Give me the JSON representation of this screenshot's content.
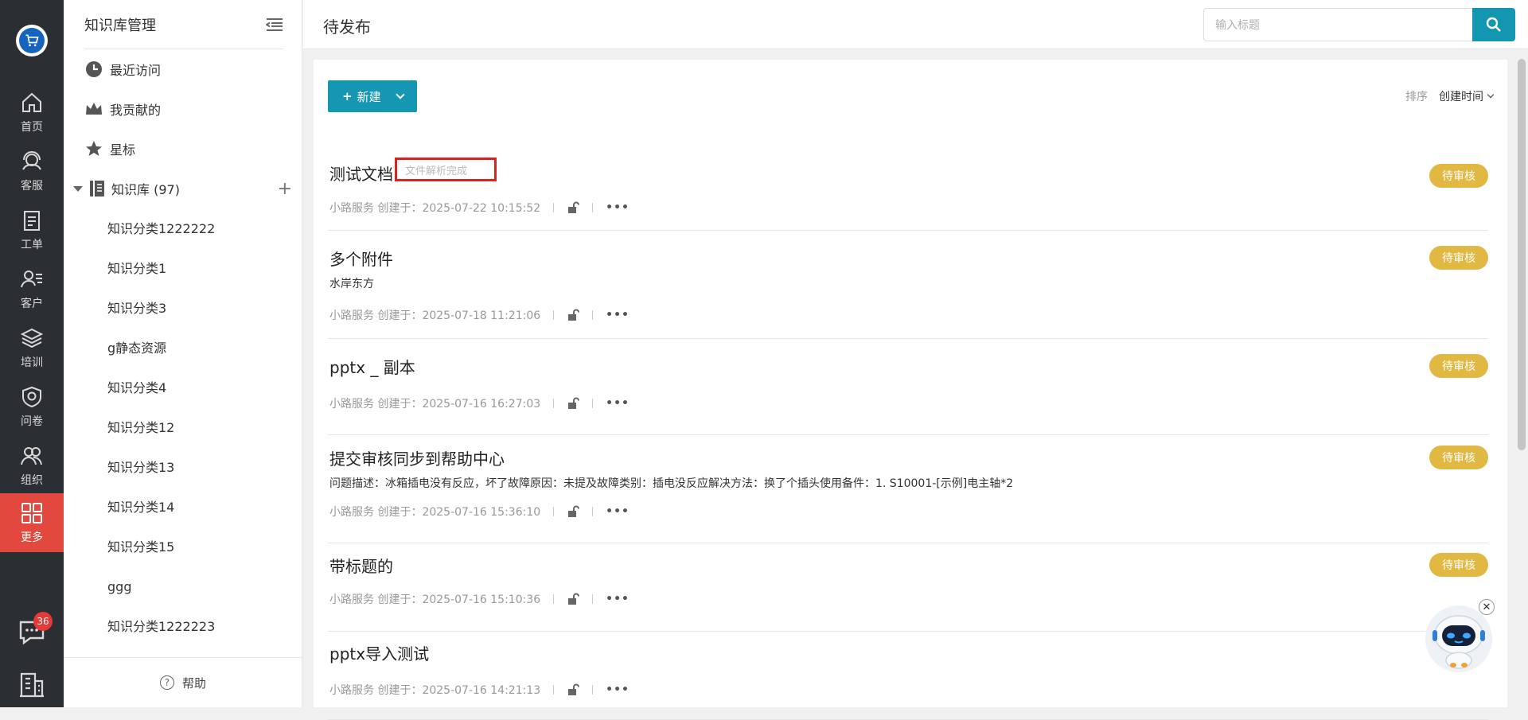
{
  "rail": {
    "items": [
      {
        "label": "首页",
        "icon": "home-icon"
      },
      {
        "label": "客服",
        "icon": "headset-icon"
      },
      {
        "label": "工单",
        "icon": "clipboard-icon"
      },
      {
        "label": "客户",
        "icon": "user-list-icon"
      },
      {
        "label": "培训",
        "icon": "layers-icon"
      },
      {
        "label": "问卷",
        "icon": "survey-shield-icon"
      },
      {
        "label": "组织",
        "icon": "group-icon"
      },
      {
        "label": "更多",
        "icon": "grid-icon",
        "active": true
      }
    ],
    "chat_badge": "36",
    "accent": "#e2483d"
  },
  "sidebar": {
    "title": "知识库管理",
    "nav": [
      {
        "label": "最近访问",
        "icon": "clock-icon"
      },
      {
        "label": "我贡献的",
        "icon": "crown-icon"
      },
      {
        "label": "星标",
        "icon": "star-icon"
      }
    ],
    "kb_label": "知识库 (97)",
    "categories": [
      "知识分类1222222",
      "知识分类1",
      "知识分类3",
      "g静态资源",
      "知识分类4",
      "知识分类12",
      "知识分类13",
      "知识分类14",
      "知识分类15",
      "ggg",
      "知识分类1222223"
    ],
    "help": "帮助"
  },
  "header": {
    "title": "待发布",
    "search_placeholder": "输入标题",
    "accent": "#1396b1"
  },
  "toolbar": {
    "new_label": "新建",
    "sort_label": "排序",
    "sort_value": "创建时间"
  },
  "docs": [
    {
      "title": "测试文档",
      "flag": "文件解析完成",
      "desc": "",
      "meta": "小路服务 创建于：2025-07-22 10:15:52",
      "status": "待审核"
    },
    {
      "title": "多个附件",
      "flag": "",
      "desc": "水岸东方",
      "meta": "小路服务 创建于：2025-07-18 11:21:06",
      "status": "待审核"
    },
    {
      "title": "pptx _ 副本",
      "flag": "",
      "desc": "",
      "meta": "小路服务 创建于：2025-07-16 16:27:03",
      "status": "待审核"
    },
    {
      "title": "提交审核同步到帮助中心",
      "flag": "",
      "desc": "问题描述：冰箱插电没有反应，坏了故障原因：未提及故障类别：插电没反应解决方法：换了个插头使用备件：1. S10001-[示例]电主轴*2",
      "meta": "小路服务 创建于：2025-07-16 15:36:10",
      "status": "待审核"
    },
    {
      "title": "带标题的",
      "flag": "",
      "desc": "",
      "meta": "小路服务 创建于：2025-07-16 15:10:36",
      "status": "待审核"
    },
    {
      "title": "pptx导入测试",
      "flag": "",
      "desc": "",
      "meta": "小路服务 创建于：2025-07-16 14:21:13",
      "status": ""
    }
  ],
  "status_color": "#e0b842"
}
